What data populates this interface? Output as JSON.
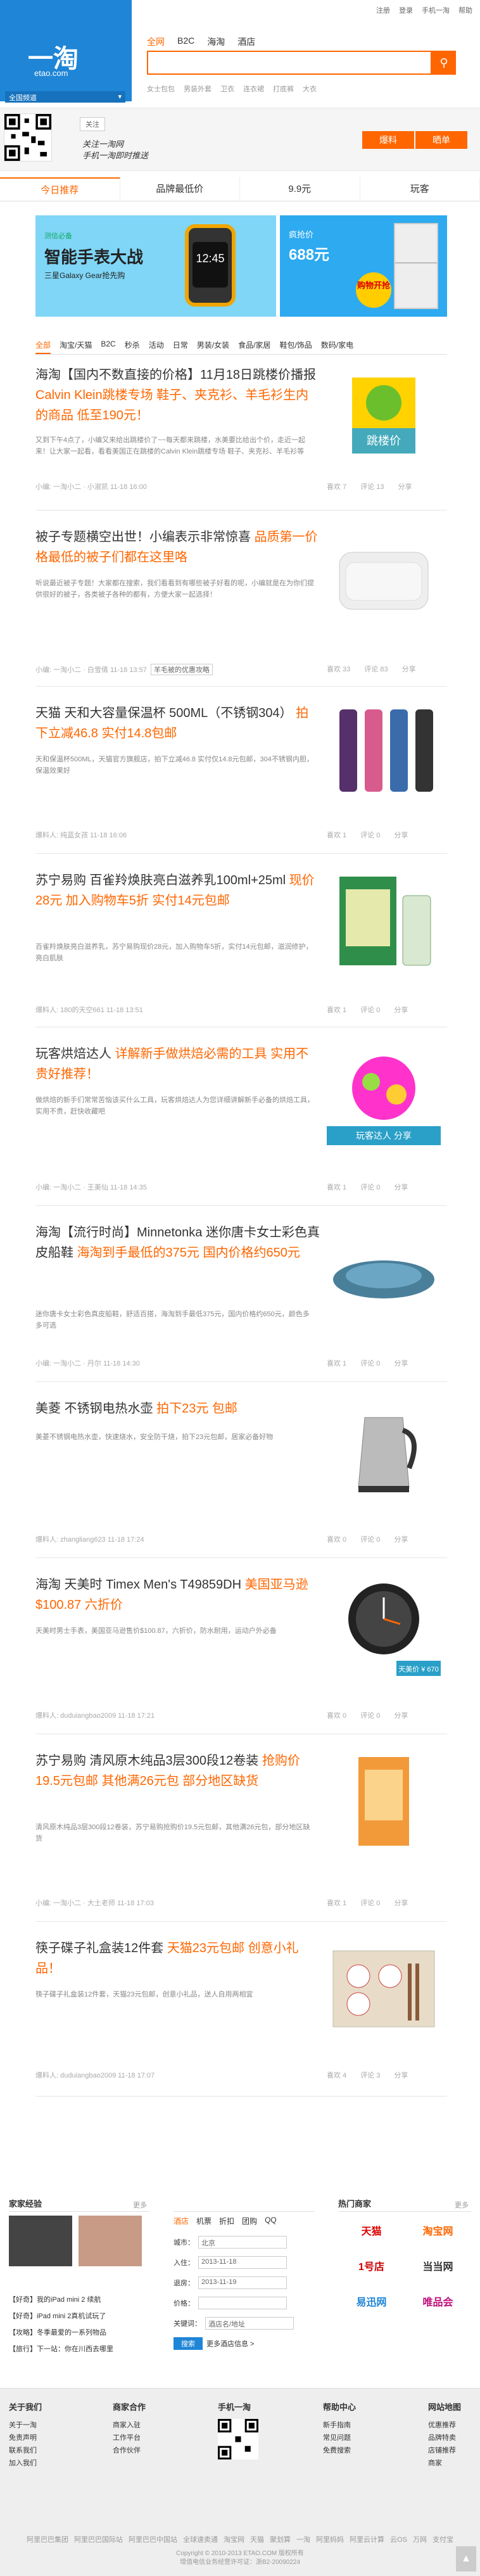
{
  "topnav": {
    "items": [
      "注册",
      "登录",
      "手机一淘",
      "帮助"
    ]
  },
  "logo": {
    "mark": "一淘",
    "url": "etao.com",
    "region": "全国频道"
  },
  "search": {
    "tabs": [
      "全网",
      "B2C",
      "海淘",
      "酒店"
    ],
    "placeholder": "",
    "button_icon": "search-icon",
    "hot": [
      "女士包包",
      "男装外套",
      "卫衣",
      "连衣裙",
      "打底裤",
      "大衣"
    ]
  },
  "sub": {
    "follow": "关注",
    "hand1": "关注一淘网",
    "hand2": "手机一淘即时推送",
    "buttons": [
      "爆料",
      "晒单"
    ]
  },
  "tabs": [
    "今日推荐",
    "品牌最低价",
    "9.9元",
    "玩客"
  ],
  "banner1": {
    "t1": "测信必备",
    "t2": "智能手表大战",
    "t3": "三星Galaxy Gear抢先购",
    "watch_time": "12:45"
  },
  "banner2": {
    "t1": "疯抢价",
    "t2": "688元",
    "badge": "购物开抢"
  },
  "cats": [
    "全部",
    "淘宝/天猫",
    "B2C",
    "秒杀",
    "活动",
    "日常",
    "男装/女装",
    "食品/家居",
    "鞋包/饰品",
    "数码/家电"
  ],
  "articles": [
    {
      "title": "海淘【国内不数直接的价格】11月18日跳楼价播报",
      "hl": "Calvin Klein跳楼专场 鞋子、夹克衫、羊毛衫生内的商品 低至190元！",
      "desc": "又到下午4点了，小编又来给出跳楼价了~~每天都来跳楼，水美要比给出个价，走近一起来！让大家一起看，看看美国正在跳楼的Calvin Klein跳楼专场 鞋子、夹克衫、羊毛衫等",
      "meta": "小编: 一淘小二 · 小淑凯  11-18 16:00",
      "stats": [
        "喜欢 7",
        "评论 13",
        "分享"
      ],
      "pic_text": "跳楼价"
    },
    {
      "title": "被子专题横空出世！小编表示非常惊喜",
      "hl": "品质第一价格最低的被子们都在这里咯",
      "desc": "听说最近被子专题！大家都在搜索，我们看看到有哪些被子好看的呢，小编就是在为你们提供很好的被子，各类被子各种的都有，方便大家一起选择！",
      "meta": "小编: 一淘小二 · 白雪倩  11-18 13:57",
      "tag": "羊毛被的优惠攻略",
      "stats": [
        "喜欢 33",
        "评论 83",
        "分享"
      ]
    },
    {
      "title": "天猫 天和大容量保温杯 500ML（不锈钢304）",
      "hl": "拍下立减46.8 实付14.8包邮",
      "desc": "天和保温杯500ML，天猫官方旗舰店，拍下立减46.8 实付仅14.8元包邮，304不锈钢内胆，保温效果好",
      "meta": "爆料人: 纯蓝女孩  11-18 16:06",
      "stats": [
        "喜欢 1",
        "评论 0",
        "分享"
      ]
    },
    {
      "title": "苏宁易购 百雀羚焕肤亮白滋养乳100ml+25ml",
      "hl": "现价28元 加入购物车5折 实付14元包邮",
      "desc": "百雀羚焕肤亮白滋养乳，苏宁易购现价28元，加入购物车5折，实付14元包邮，滋润修护，亮白肌肤",
      "meta": "爆料人: 180的天空661  11-18 13:51",
      "stats": [
        "喜欢 1",
        "评论 0",
        "分享"
      ]
    },
    {
      "title": "玩客烘焙达人",
      "hl": "详解新手做烘焙必需的工具 实用不贵好推荐！",
      "desc": "做烘焙的新手们常常苦恼该买什么工具，玩客烘焙达人为您详细讲解新手必备的烘焙工具，实用不贵，赶快收藏吧",
      "meta": "小编: 一淘小二 · 王美仙  11-18 14:35",
      "stats": [
        "喜欢 1",
        "评论 0",
        "分享"
      ],
      "pic_text": "玩客达人 分享"
    },
    {
      "title": "海淘【流行时尚】Minnetonka 迷你唐卡女士彩色真皮船鞋",
      "hl": "海淘到手最低的375元 国内价格约650元",
      "desc": "迷你唐卡女士彩色真皮船鞋，舒适百搭，海淘到手最低375元，国内价格约650元，颜色多多可选",
      "meta": "小编: 一淘小二 · 丹尔  11-18 14:30",
      "stats": [
        "喜欢 1",
        "评论 0",
        "分享"
      ]
    },
    {
      "title": "美菱 不锈钢电热水壶",
      "hl": "拍下23元 包邮",
      "desc": "美菱不锈钢电热水壶，快速烧水，安全防干烧，拍下23元包邮，居家必备好物",
      "meta": "爆料人: zhangliang623  11-18 17:24",
      "stats": [
        "喜欢 0",
        "评论 0",
        "分享"
      ]
    },
    {
      "title": "海淘 天美时 Timex Men's T49859DH",
      "hl": "美国亚马逊 $100.87 六折价",
      "desc": "天美时男士手表，美国亚马逊售价$100.87，六折价，防水耐用，运动户外必备",
      "meta": "爆料人: duduiangbao2009  11-18 17:21",
      "stats": [
        "喜欢 0",
        "评论 0",
        "分享"
      ],
      "pic_text": "天美价 ¥ 670"
    },
    {
      "title": "苏宁易购 清风原木纯品3层300段12卷装",
      "hl": "抢购价19.5元包邮 其他满26元包 部分地区缺货",
      "desc": "清风原木纯品3层300段12卷装，苏宁易购抢购价19.5元包邮，其他满26元包，部分地区缺货",
      "meta": "小编: 一淘小二 · 大土老师  11-18 17:03",
      "stats": [
        "喜欢 1",
        "评论 0",
        "分享"
      ]
    },
    {
      "title": "筷子碟子礼盒装12件套",
      "hl": "天猫23元包邮 创意小礼品！",
      "desc": "筷子碟子礼盒装12件套，天猫23元包邮，创意小礼品，送人自用两相宜",
      "meta": "爆料人: duduiangbao2009  11-18 17:07",
      "stats": [
        "喜欢 4",
        "评论 3",
        "分享"
      ]
    }
  ],
  "mod1": {
    "title": "家家经验",
    "more": "更多",
    "items": [
      "【好奇】我的iPad mini 2 续航",
      "【好奇】iPad mini 2真机试玩了",
      "【攻略】冬季最爱的一系列物品",
      "【旅行】下一站：你在川西去哪里"
    ]
  },
  "mod2": {
    "title": "",
    "tabs": [
      "酒店",
      "机票",
      "折扣",
      "团购",
      "QQ"
    ],
    "more": "",
    "rows": [
      {
        "label": "城市：",
        "value": "北京"
      },
      {
        "label": "入住：",
        "value": "2013-11-18"
      },
      {
        "label": "退房：",
        "value": "2013-11-19"
      },
      {
        "label": "价格：",
        "value": ""
      },
      {
        "label": "关键词：",
        "value": "酒店名/地址"
      }
    ],
    "button": "搜索",
    "link": "更多酒店信息 >"
  },
  "mod3": {
    "title": "热门商家",
    "more": "更多",
    "logos": [
      {
        "name": "天猫",
        "color": "#d00"
      },
      {
        "name": "淘宝网",
        "color": "#f60"
      },
      {
        "name": "1号店",
        "color": "#c00"
      },
      {
        "name": "当当网",
        "color": "#333"
      },
      {
        "name": "易迅网",
        "color": "#1f85d6"
      },
      {
        "name": "唯品会",
        "color": "#c0107a"
      }
    ]
  },
  "footer": {
    "cols": [
      {
        "title": "关于我们",
        "items": [
          "关于一淘",
          "免责声明",
          "联系我们",
          "加入我们"
        ]
      },
      {
        "title": "商家合作",
        "items": [
          "商家入驻",
          "工作平台",
          "合作伙伴"
        ]
      },
      {
        "title": "手机一淘",
        "items": []
      },
      {
        "title": "帮助中心",
        "items": [
          "新手指南",
          "常见问题",
          "免费搜索"
        ]
      },
      {
        "title": "网站地图",
        "items": [
          "优惠推荐",
          "品牌特卖",
          "店铺推荐",
          "商家"
        ]
      }
    ],
    "links": [
      "阿里巴巴集团",
      "阿里巴巴国际站",
      "阿里巴巴中国站",
      "全球速卖通",
      "淘宝网",
      "天猫",
      "聚划算",
      "一淘",
      "阿里妈妈",
      "阿里云计算",
      "云OS",
      "万网",
      "支付宝"
    ],
    "copy1": "Copyright © 2010-2013 ETAO.COM 版权所有",
    "copy2": "增值电信业务经营许可证：浙B2-20090224"
  },
  "totop": "▲"
}
